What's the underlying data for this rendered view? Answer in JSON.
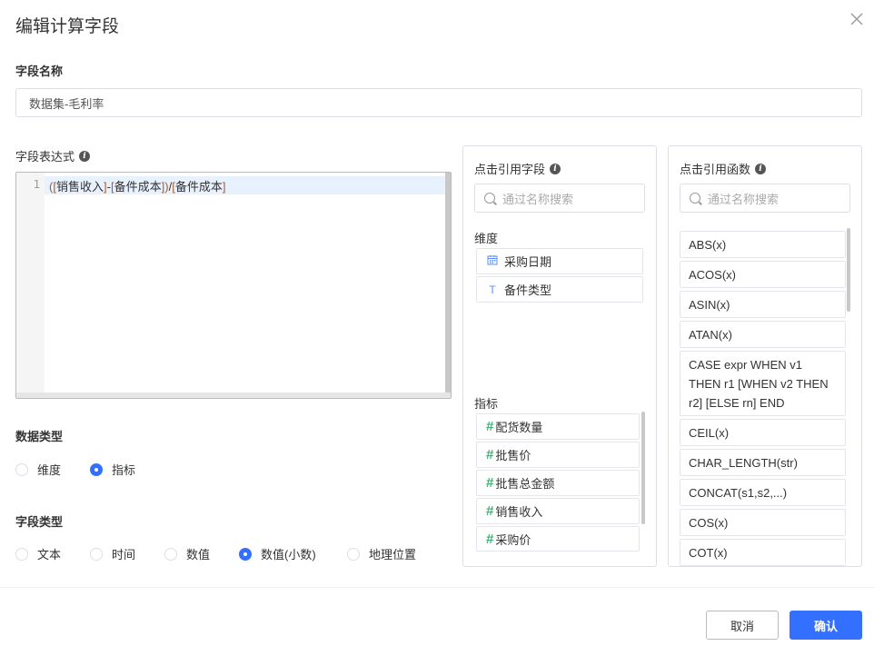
{
  "dialog": {
    "title": "编辑计算字段",
    "cancel_label": "取消",
    "confirm_label": "确认"
  },
  "field_name": {
    "label": "字段名称",
    "value": "数据集-毛利率"
  },
  "expression": {
    "label": "字段表达式",
    "line_number": "1",
    "tokens": [
      "(",
      "[",
      "销售收入",
      "]",
      "-",
      "[",
      "备件成本",
      "]",
      ")",
      "/",
      "[",
      "备件成本",
      "]"
    ]
  },
  "data_type": {
    "label": "数据类型",
    "options": [
      {
        "label": "维度",
        "selected": false
      },
      {
        "label": "指标",
        "selected": true
      }
    ]
  },
  "field_type": {
    "label": "字段类型",
    "options": [
      {
        "label": "文本",
        "selected": false
      },
      {
        "label": "时间",
        "selected": false
      },
      {
        "label": "数值",
        "selected": false
      },
      {
        "label": "数值(小数)",
        "selected": true
      },
      {
        "label": "地理位置",
        "selected": false
      }
    ]
  },
  "fields_panel": {
    "title": "点击引用字段",
    "search_placeholder": "通过名称搜索",
    "dimension_label": "维度",
    "dimensions": [
      {
        "label": "采购日期",
        "icon": "calendar-icon"
      },
      {
        "label": "备件类型",
        "icon": "text-type-icon"
      }
    ],
    "metric_label": "指标",
    "metrics": [
      "配货数量",
      "批售价",
      "批售总金额",
      "销售收入",
      "采购价"
    ]
  },
  "functions_panel": {
    "title": "点击引用函数",
    "search_placeholder": "通过名称搜索",
    "functions": [
      "ABS(x)",
      "ACOS(x)",
      "ASIN(x)",
      "ATAN(x)",
      "CASE expr WHEN v1 THEN r1 [WHEN v2 THEN r2] [ELSE rn] END",
      "CEIL(x)",
      "CHAR_LENGTH(str)",
      "CONCAT(s1,s2,...)",
      "COS(x)",
      "COT(x)"
    ]
  },
  "colors": {
    "accent": "#3370ff",
    "metric_hash": "#3cb371"
  }
}
